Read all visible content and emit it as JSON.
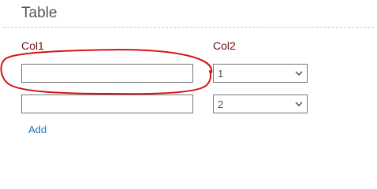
{
  "section": {
    "title": "Table"
  },
  "columns": {
    "col1_label": "Col1",
    "col2_label": "Col2"
  },
  "rows": [
    {
      "text_value": "",
      "select_value": "1"
    },
    {
      "text_value": "",
      "select_value": "2"
    }
  ],
  "actions": {
    "add_label": "Add"
  },
  "colors": {
    "label": "#6b0f14",
    "link": "#1f6fb0",
    "annotation": "#d41414"
  },
  "annotation": {
    "shape": "freehand-ellipse",
    "encloses": "row-1-text-input"
  }
}
